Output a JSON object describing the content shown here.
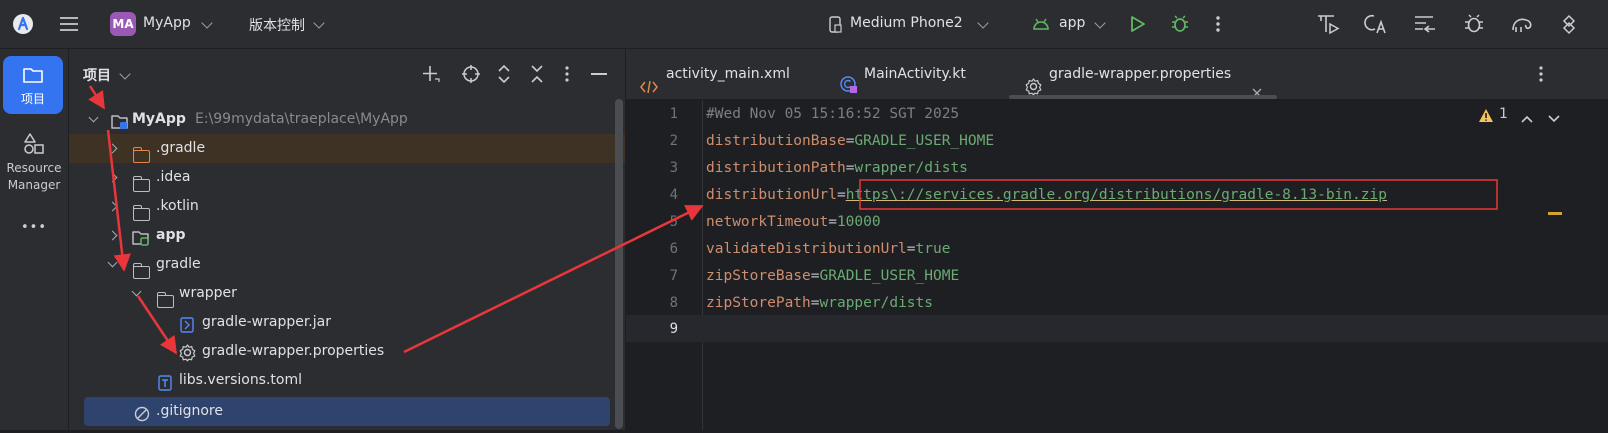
{
  "toolbar": {
    "main_menu": "Main menu",
    "project_badge": "MA",
    "project_name": "MyApp",
    "vcs_label": "版本控制",
    "device_name": "Medium Phone2",
    "run_config": "app"
  },
  "rail": {
    "project_label": "项目",
    "resource_manager_line1": "Resource",
    "resource_manager_line2": "Manager",
    "more": "•••"
  },
  "project_pane": {
    "title": "项目",
    "root_name": "MyApp",
    "root_path": "E:\\99mydata\\traeplace\\MyApp",
    "items": [
      {
        "label": ".gradle"
      },
      {
        "label": ".idea"
      },
      {
        "label": ".kotlin"
      },
      {
        "label": "app"
      },
      {
        "label": "gradle"
      },
      {
        "label": "wrapper"
      },
      {
        "label": "gradle-wrapper.jar"
      },
      {
        "label": "gradle-wrapper.properties"
      },
      {
        "label": "libs.versions.toml"
      },
      {
        "label": ".gitignore"
      }
    ]
  },
  "editor": {
    "tabs": [
      {
        "label": "activity_main.xml"
      },
      {
        "label": "MainActivity.kt"
      },
      {
        "label": "gradle-wrapper.properties"
      }
    ],
    "warning_count": "1",
    "lines": [
      {
        "num": "1",
        "comment": "#Wed Nov 05 15:16:52 SGT 2025"
      },
      {
        "num": "2",
        "key": "distributionBase",
        "value": "GRADLE_USER_HOME"
      },
      {
        "num": "3",
        "key": "distributionPath",
        "value": "wrapper/dists"
      },
      {
        "num": "4",
        "key": "distributionUrl",
        "value": "https\\://services.gradle.org/distributions/gradle-8.13-bin.zip"
      },
      {
        "num": "5",
        "key": "networkTimeout",
        "value": "10000"
      },
      {
        "num": "6",
        "key": "validateDistributionUrl",
        "value": "true"
      },
      {
        "num": "7",
        "key": "zipStoreBase",
        "value": "GRADLE_USER_HOME"
      },
      {
        "num": "8",
        "key": "zipStorePath",
        "value": "wrapper/dists"
      },
      {
        "num": "9"
      }
    ]
  },
  "colors": {
    "annotation_red": "#e8363a",
    "accent_blue": "#3574f0",
    "run_green": "#5fb865"
  }
}
